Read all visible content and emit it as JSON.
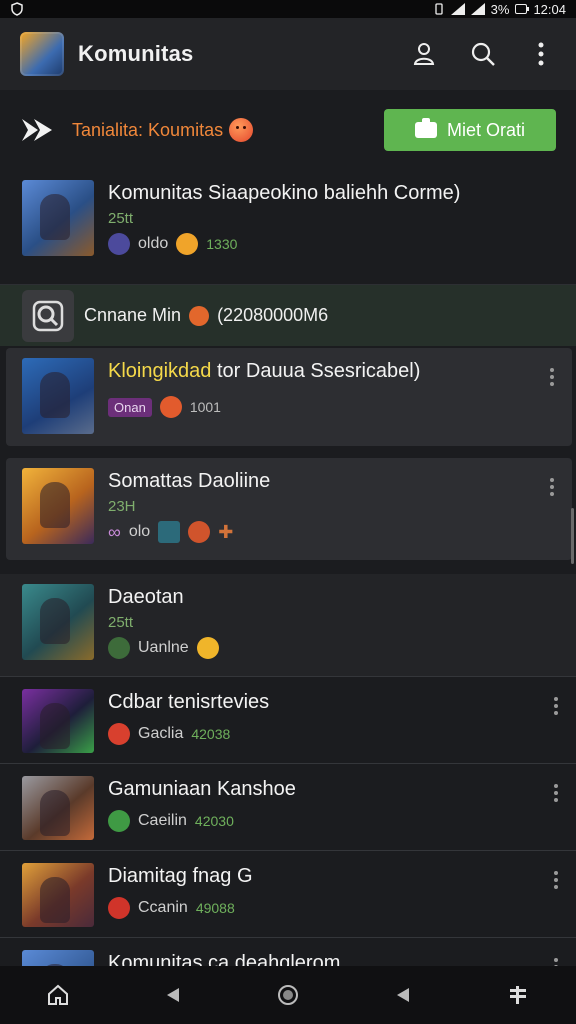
{
  "status": {
    "battery_text": "3%",
    "time": "12:04"
  },
  "appbar": {
    "title": "Komunitas"
  },
  "banner": {
    "text": "Tanialita: Koumitas",
    "button_label": "Miet Orati"
  },
  "section": {
    "label": "Cnnane Min",
    "count": "(22080000M6"
  },
  "items": [
    {
      "title": "Komunitas Siaapeokino baliehh Corme)",
      "sub": "25tt",
      "meta": "oldo",
      "num": "1330"
    },
    {
      "title_highlight": "Kloingikdad",
      "title_rest": " tor Dauua Ssesricabel)",
      "tag": "Onan",
      "num": "1001"
    },
    {
      "title": "Somattas Daoliine",
      "sub": "23H",
      "meta": "olo"
    },
    {
      "title": "Daeotan",
      "sub": "25tt",
      "meta": "Uanlne"
    },
    {
      "title": "Cdbar tenisrtevies",
      "meta": "Gaclia",
      "num": "42038"
    },
    {
      "title": "Gamuniaan Kanshoe",
      "meta": "Caeilin",
      "num": "42030"
    },
    {
      "title": "Diamitag fnag G",
      "meta": "Ccanin",
      "num": "49088"
    },
    {
      "title": "Komunitas ca deahglerom"
    }
  ],
  "colors": {
    "accent_green": "#5fb550",
    "banner_orange": "#f0873a",
    "highlight_yellow": "#f5d94a",
    "meta_green": "#6fb05c"
  }
}
